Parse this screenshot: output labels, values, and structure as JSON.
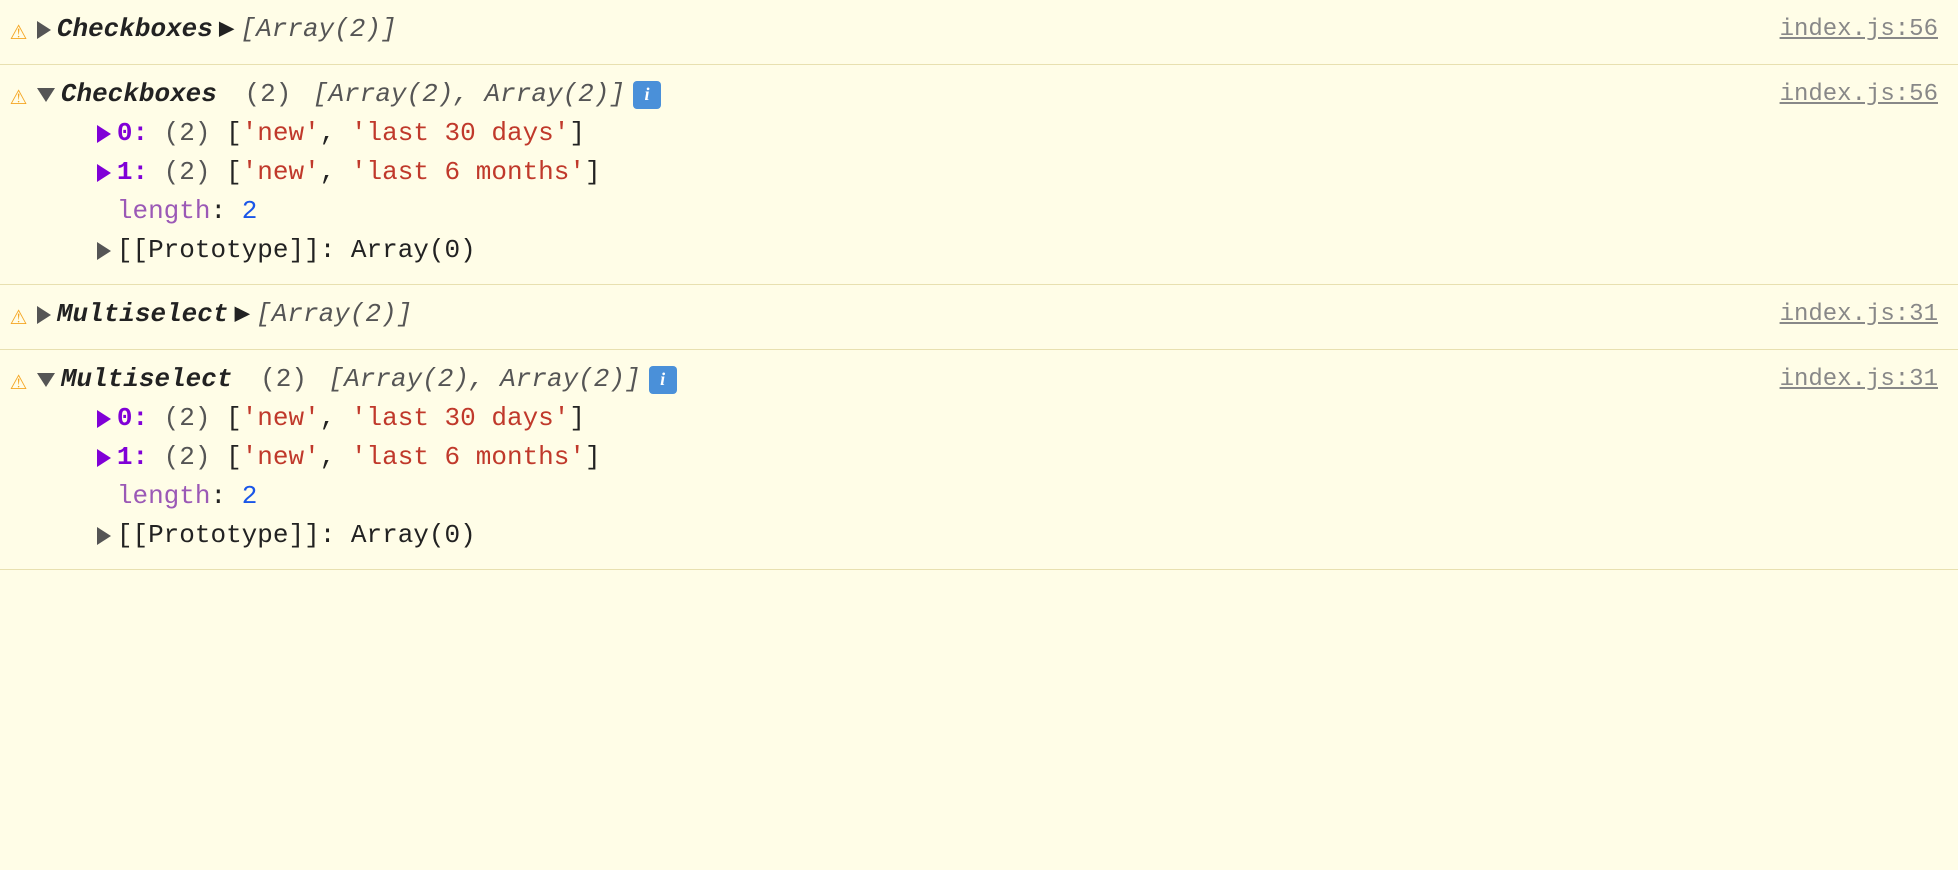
{
  "rows": [
    {
      "id": "row1",
      "warning": "⚠",
      "collapsed": true,
      "label": "Checkboxes",
      "arrow": "right",
      "summary": "[Array(2)]",
      "fileLink": "index.js:56",
      "expanded": false
    },
    {
      "id": "row2",
      "warning": "⚠",
      "collapsed": false,
      "label": "Checkboxes",
      "arrow": "down",
      "count": "(2)",
      "summaryExpanded": "[Array(2), Array(2)]",
      "showInfo": true,
      "fileLink": "index.js:56",
      "expanded": true,
      "children": [
        {
          "index": "0",
          "count": "(2)",
          "items": [
            "'new'",
            "'last 30 days'"
          ]
        },
        {
          "index": "1",
          "count": "(2)",
          "items": [
            "'new'",
            "'last 6 months'"
          ]
        }
      ],
      "lengthKey": "length",
      "lengthVal": "2",
      "prototype": "[[Prototype]]: Array(0)"
    },
    {
      "id": "row3",
      "warning": "⚠",
      "collapsed": true,
      "label": "Multiselect",
      "arrow": "right",
      "summary": "[Array(2)]",
      "fileLink": "index.js:31",
      "expanded": false
    },
    {
      "id": "row4",
      "warning": "⚠",
      "collapsed": false,
      "label": "Multiselect",
      "arrow": "down",
      "count": "(2)",
      "summaryExpanded": "[Array(2), Array(2)]",
      "showInfo": true,
      "fileLink": "index.js:31",
      "expanded": true,
      "children": [
        {
          "index": "0",
          "count": "(2)",
          "items": [
            "'new'",
            "'last 30 days'"
          ]
        },
        {
          "index": "1",
          "count": "(2)",
          "items": [
            "'new'",
            "'last 6 months'"
          ]
        }
      ],
      "lengthKey": "length",
      "lengthVal": "2",
      "prototype": "[[Prototype]]: Array(0)"
    }
  ],
  "labels": {
    "row1_label": "Checkboxes",
    "row1_summary": "[Array(2)]",
    "row1_file": "index.js:56",
    "row2_label": "Checkboxes",
    "row2_count": "(2)",
    "row2_summary": "[Array(2), Array(2)]",
    "row2_file": "index.js:56",
    "row2_c0_index": "▶0:",
    "row2_c0_count": "(2)",
    "row2_c0_items": "['new', 'last 30 days']",
    "row2_c1_index": "▶1:",
    "row2_c1_count": "(2)",
    "row2_c1_items": "['new', 'last 6 months']",
    "row2_length_key": "length",
    "row2_length_val": "2",
    "row2_proto": "▶[[Prototype]]: Array(0)",
    "row3_label": "Multiselect",
    "row3_summary": "[Array(2)]",
    "row3_file": "index.js:31",
    "row4_label": "Multiselect",
    "row4_count": "(2)",
    "row4_summary": "[Array(2), Array(2)]",
    "row4_file": "index.js:31",
    "row4_c0_index": "▶0:",
    "row4_c0_count": "(2)",
    "row4_c0_items": "['new', 'last 30 days']",
    "row4_c1_index": "▶1:",
    "row4_c1_count": "(2)",
    "row4_c1_items": "['new', 'last 6 months']",
    "row4_length_key": "length",
    "row4_length_val": "2",
    "row4_proto": "▶[[Prototype]]: Array(0)"
  }
}
